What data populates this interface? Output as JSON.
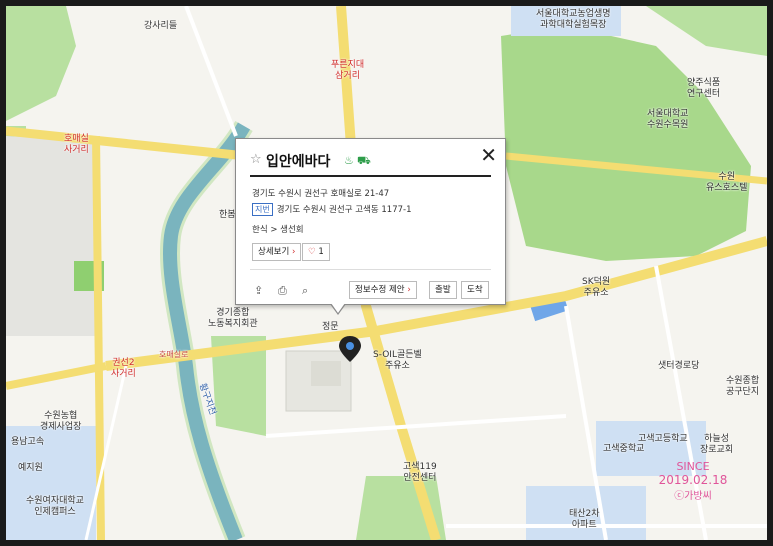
{
  "place": {
    "name": "입안에바다",
    "road_address": "경기도 수원시 권선구 호매실로 21-47",
    "lot_label": "지번",
    "lot_address": "경기도 수원시 권선구 고색동 1177-1",
    "category": "한식 > 생선회",
    "detail_button": "상세보기",
    "like_count": "1",
    "edit_button": "정보수정 제안",
    "depart_button": "출발",
    "arrive_button": "도착"
  },
  "labels": {
    "gangsari": "강사리들",
    "green_geori": "푸른지대\n삼거리",
    "homaesil": "호매실\n사거리",
    "seoul_univ_top": "서울대학교농업생명\n과학대학실험목장",
    "yangjusikpum": "양주식품\n연구센터",
    "suwon_arboretum": "서울대학교\n수원수목원",
    "suwon_hostel": "수원\n유스호스텔",
    "welfare": "경기종합\n노동복지회관",
    "jeongmun": "정문",
    "soil": "S-OIL골든벨\n주유소",
    "sk": "SK덕원\n주유소",
    "saetur": "샛터경로당",
    "gwonseon2": "권선2\n사거리",
    "homae_road": "호매실로",
    "hwangguji": "황구지천",
    "nonghyup": "수원농협\n경제사업장",
    "yongnam": "용남고속",
    "yejiwon": "예지원",
    "womens_univ": "수원여자대학교\n인제캠퍼스",
    "fire": "고색119\n안전센터",
    "goesaek_high": "고색고등학교",
    "goesaek_mid": "고색중학교",
    "haneul": "하늘성\n장로교회",
    "suwon_complex": "수원종합\n공구단지",
    "taesan": "태산2차\n아파트",
    "hanbom": "한봄"
  },
  "stamp": {
    "since": "SINCE",
    "date": "2019.02.18",
    "owner": "ⓒ가방씨"
  },
  "colors": {
    "green": "#a8d88b",
    "road": "#f4dd72",
    "river": "#6fa6e8",
    "block": "#cfe0f3"
  }
}
